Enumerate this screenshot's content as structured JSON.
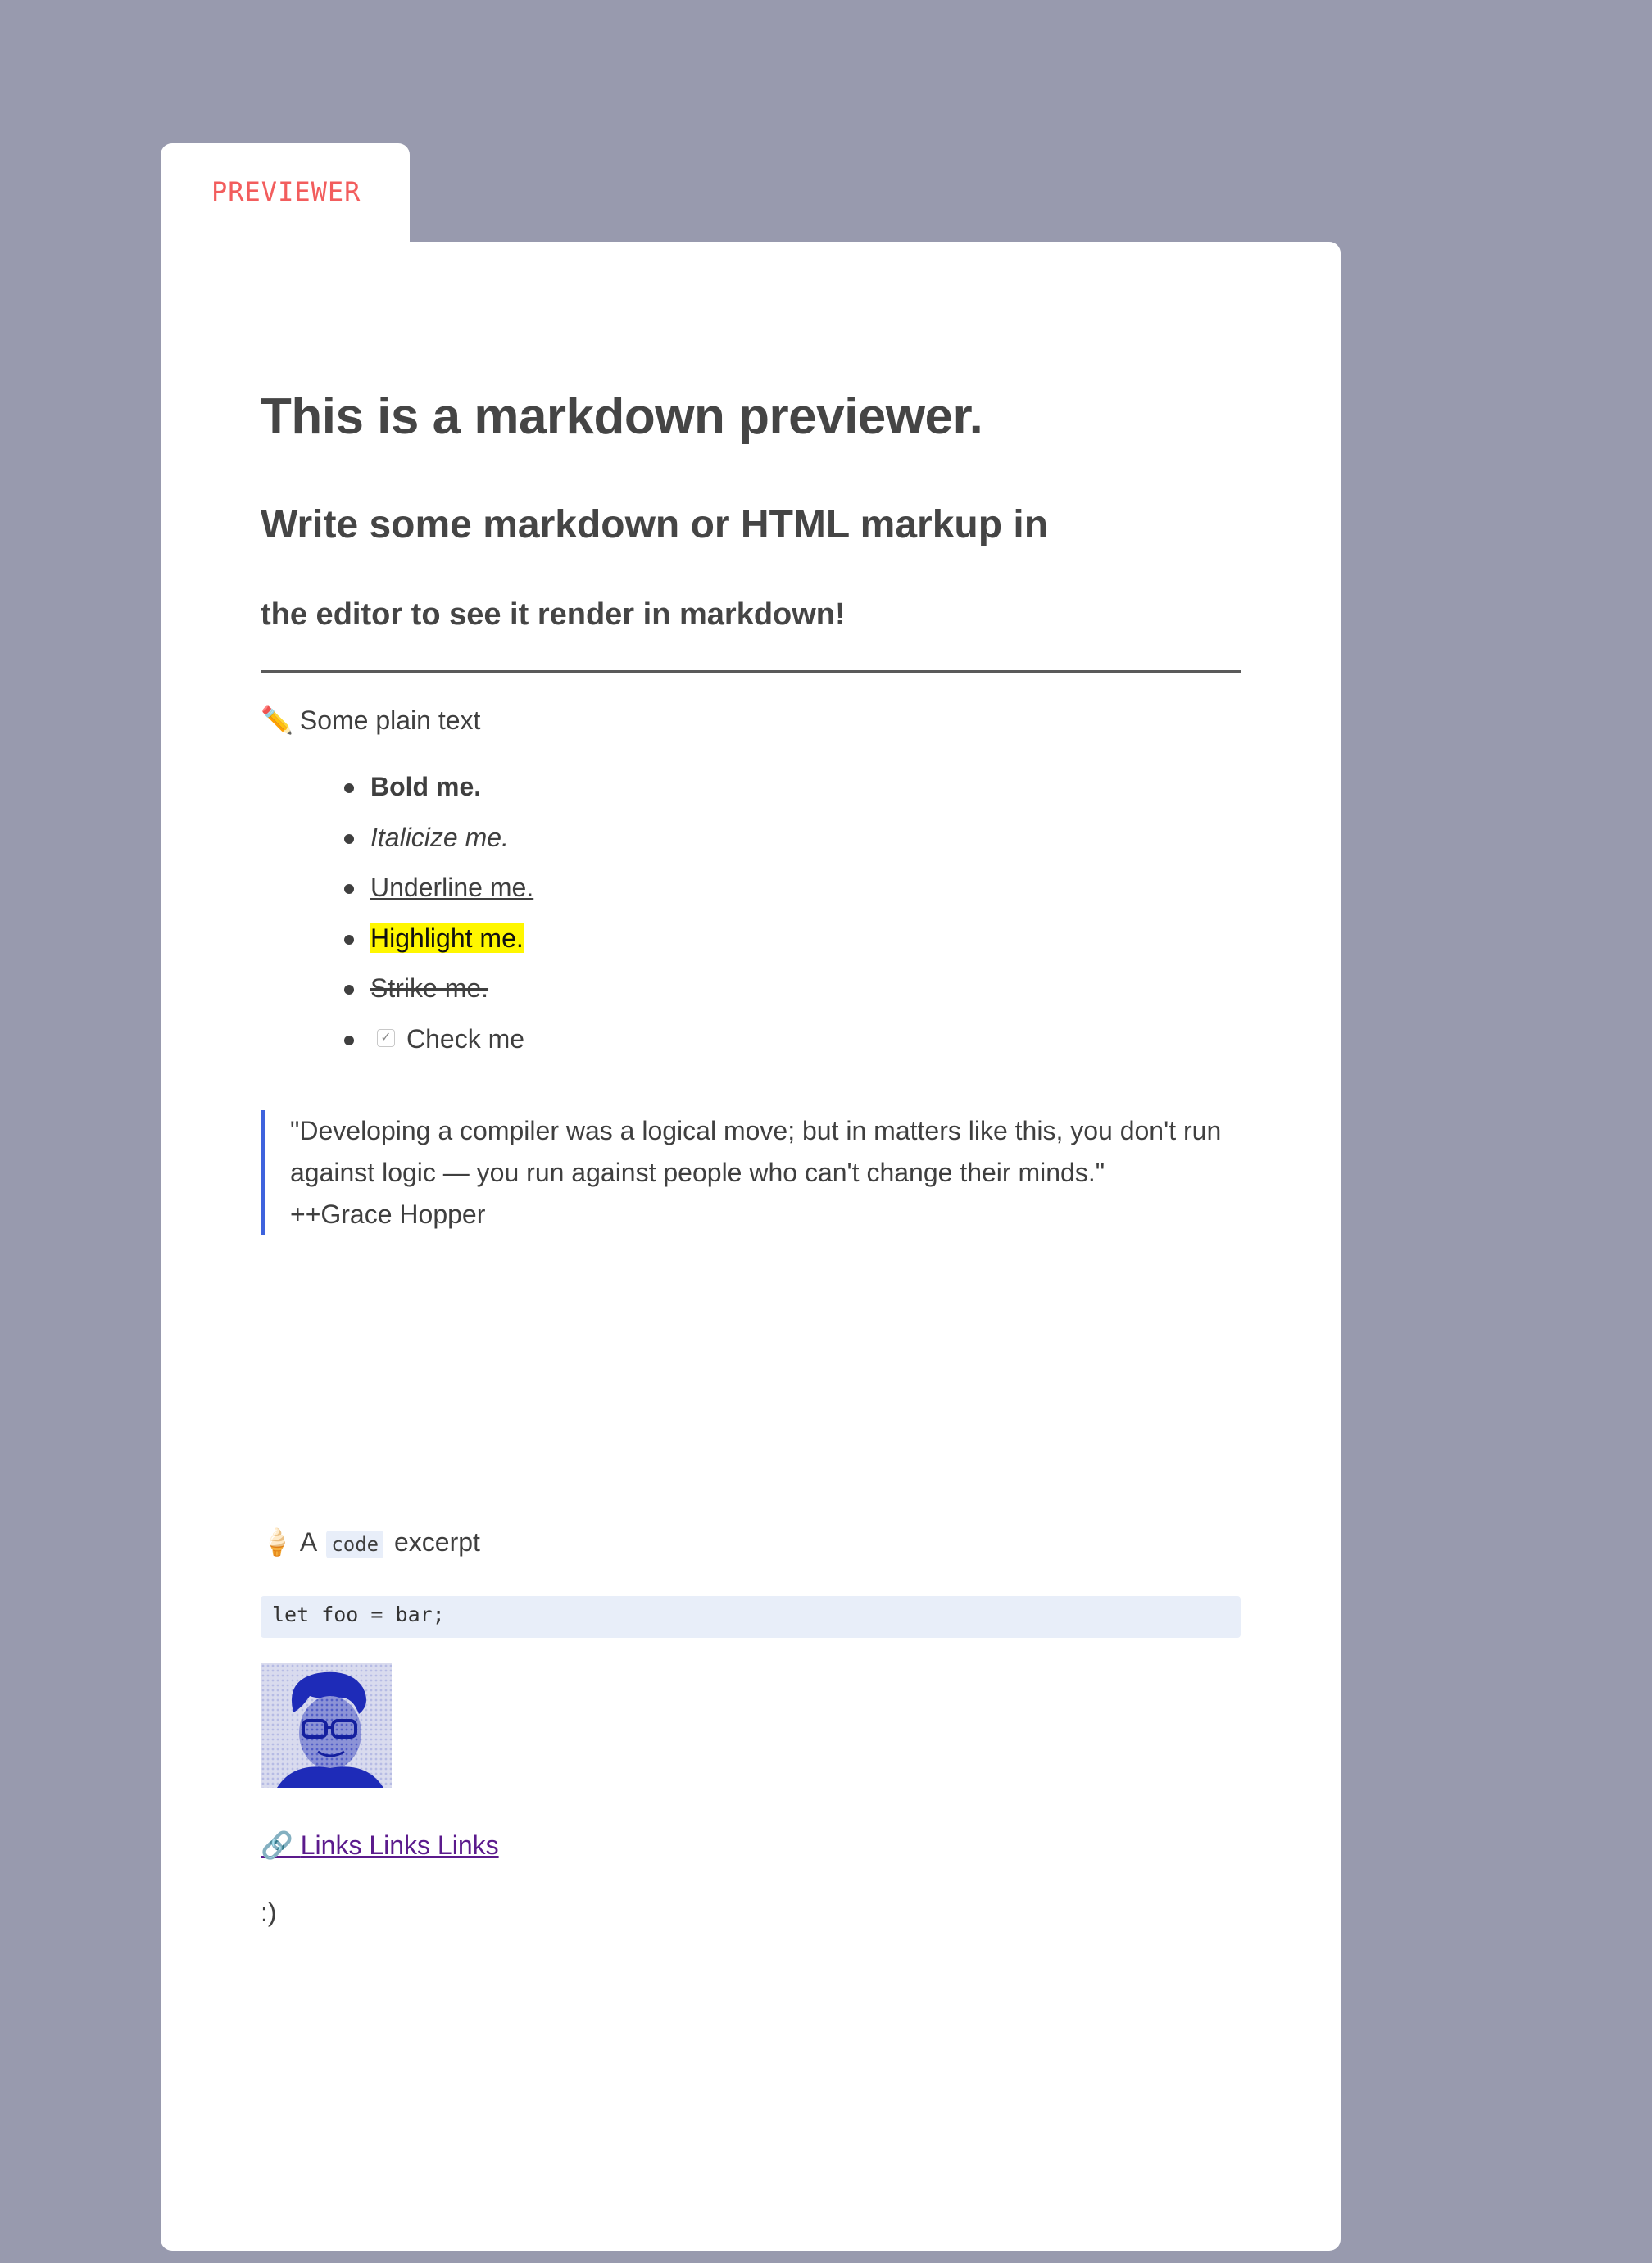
{
  "tab": {
    "label": "PREVIEWER"
  },
  "preview": {
    "h1": "This is a markdown previewer.",
    "h2": "Write some markdown or HTML markup in",
    "h3": "the editor to see it render in markdown!",
    "plain_icon": "✏️",
    "plain_text": "Some plain text",
    "list": [
      {
        "label": "Bold me."
      },
      {
        "label": "Italicize me."
      },
      {
        "label": "Underline me."
      },
      {
        "label": "Highlight me."
      },
      {
        "label": "Strike me."
      },
      {
        "label": "Check me",
        "checkbox_glyph": "✓"
      }
    ],
    "quote": {
      "text": "\"Developing a compiler was a logical move; but in matters like this, you don't run against logic — you run against people who can't change their minds.\"",
      "attribution": "++Grace Hopper"
    },
    "code_line": {
      "icon": "🍦",
      "prefix": "A",
      "inline_code": "code",
      "suffix": "excerpt"
    },
    "code_block": "let foo = bar;",
    "links": {
      "icon": "🔗",
      "label": "Links Links Links"
    },
    "smile": ":)"
  },
  "colors": {
    "background": "#989aae",
    "tab_label": "#f25d5d",
    "quote_border": "#3e63dd",
    "highlight": "#fff700",
    "link": "#5b1a8c",
    "code_bg": "#e8eef9"
  }
}
